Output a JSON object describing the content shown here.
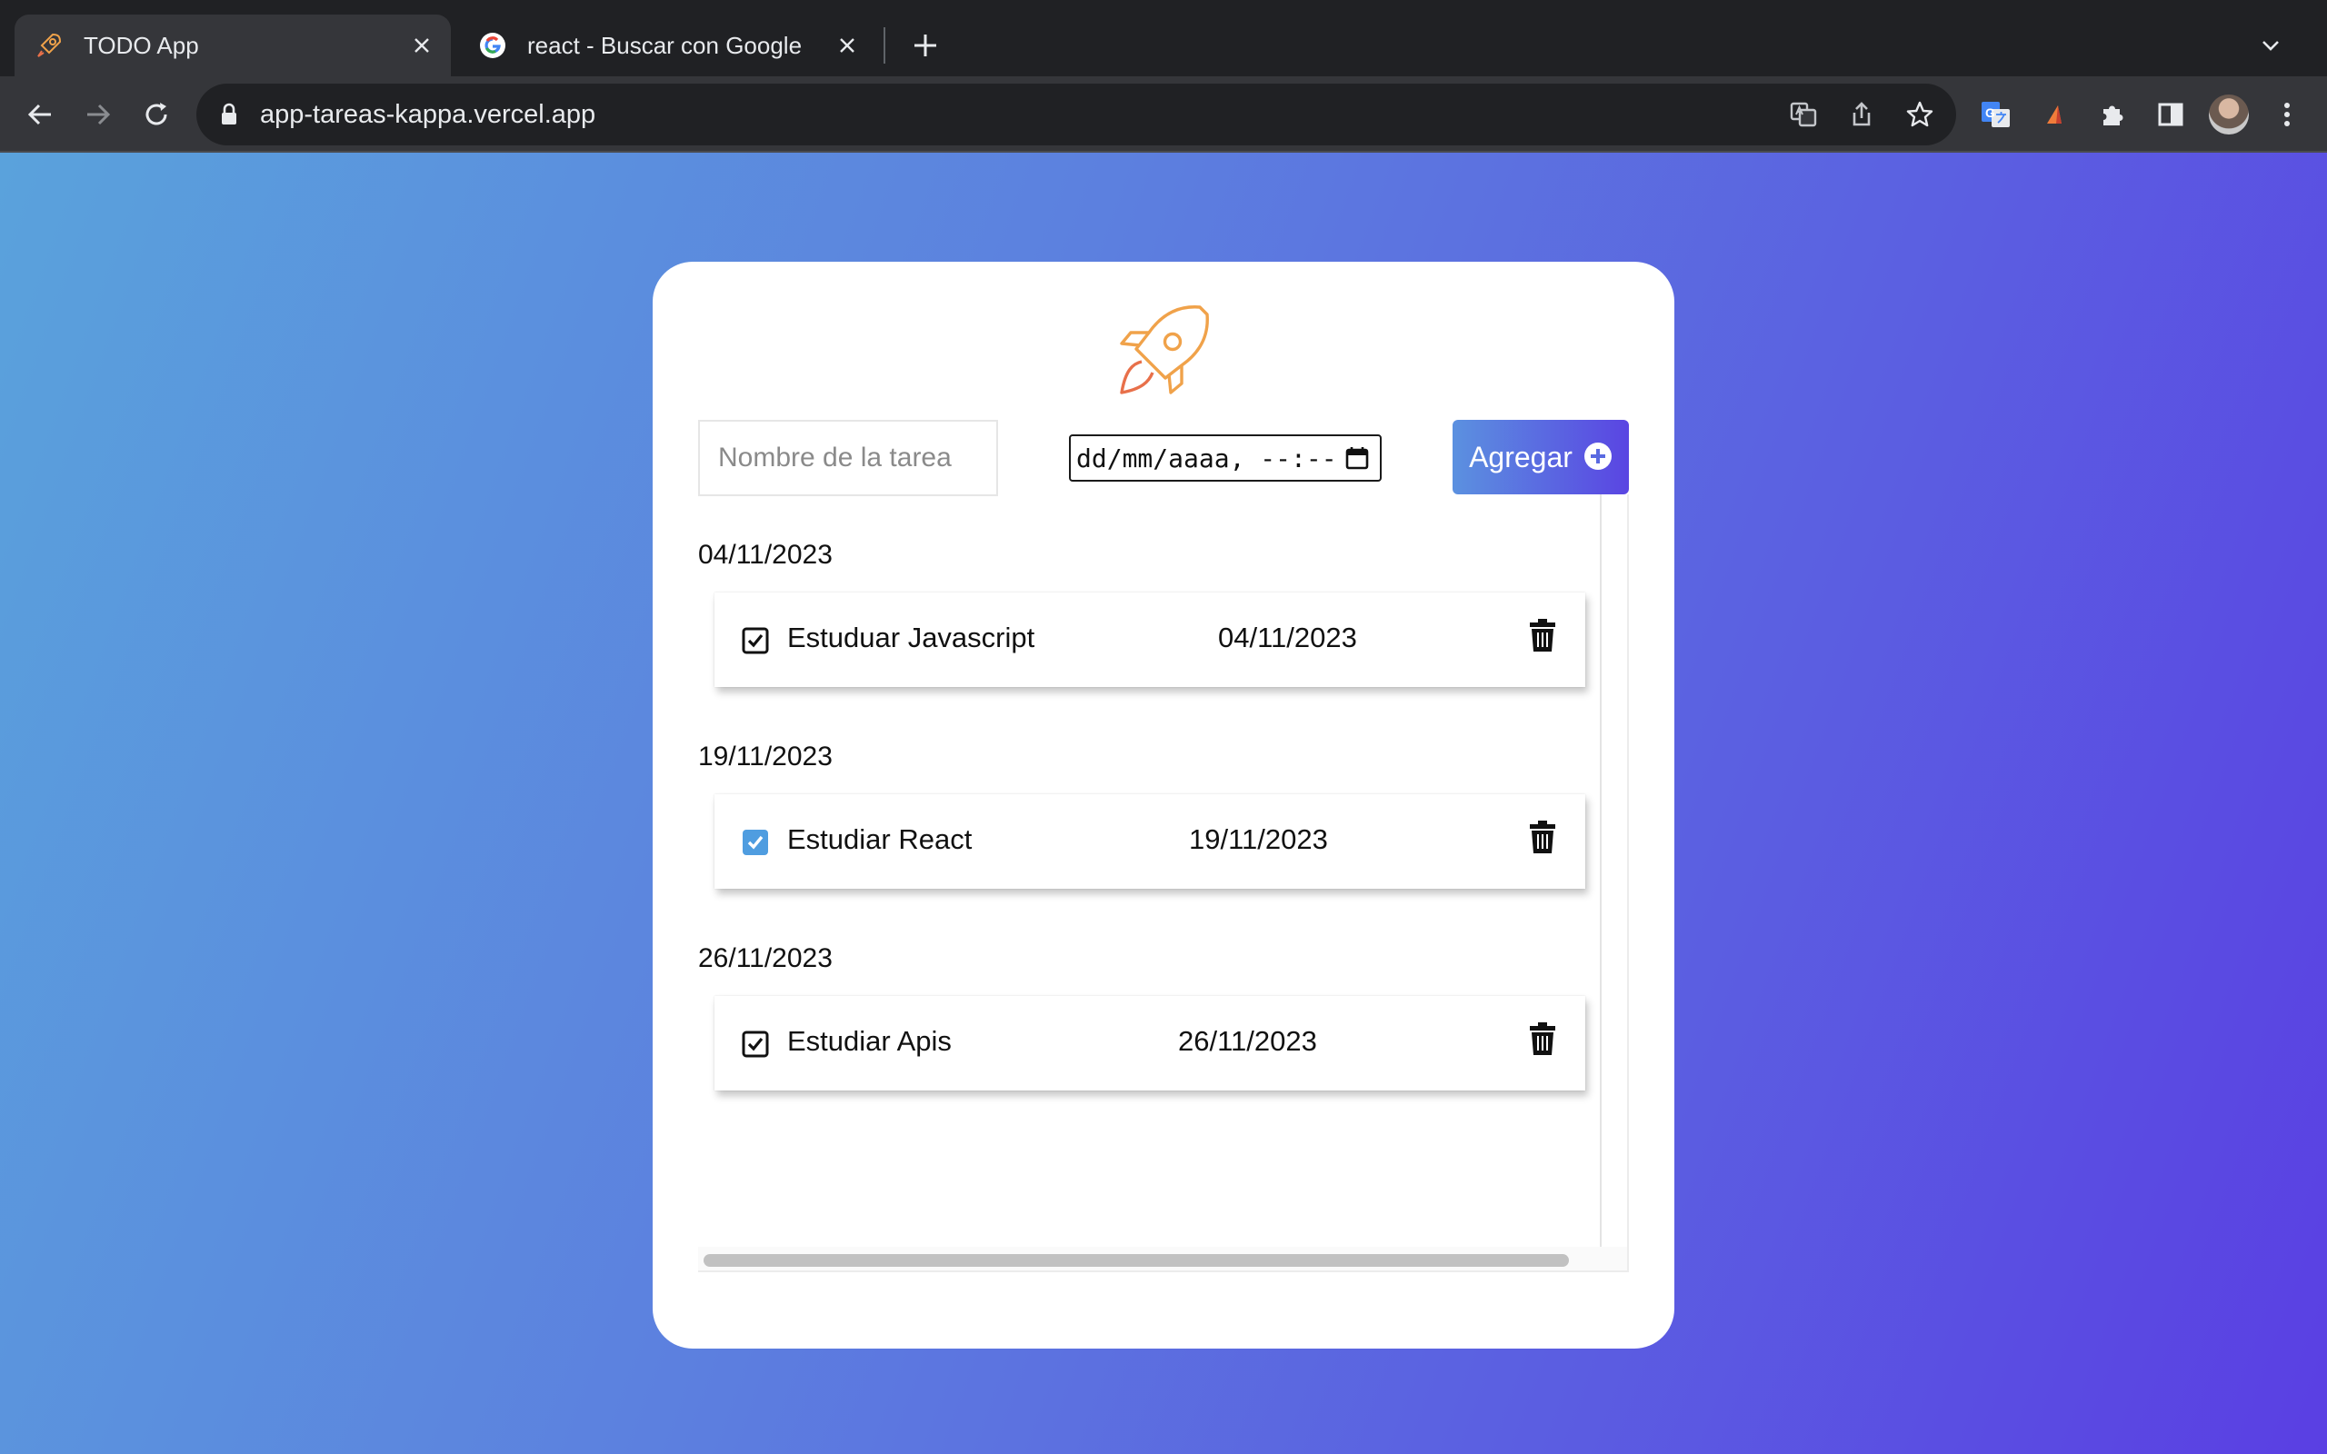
{
  "browser": {
    "tabs": [
      {
        "title": "TODO App",
        "active": true,
        "favicon": "rocket-icon"
      },
      {
        "title": "react - Buscar con Google",
        "active": false,
        "favicon": "google-icon"
      }
    ],
    "url": "app-tareas-kappa.vercel.app",
    "toolbar_icons": [
      "back-icon",
      "forward-icon",
      "reload-icon",
      "lock-icon",
      "translate-icon",
      "share-icon",
      "bookmark-star-icon",
      "google-translate-extension-icon",
      "extension-icon",
      "puzzle-icon",
      "side-panel-icon",
      "avatar",
      "kebab-menu-icon"
    ]
  },
  "app": {
    "task_input": {
      "placeholder": "Nombre de la tarea",
      "value": ""
    },
    "date_input": {
      "value": "dd/mm/aaaa, --:--"
    },
    "add_button": {
      "label": "Agregar"
    },
    "groups": [
      {
        "date": "04/11/2023",
        "tasks": [
          {
            "name": "Estuduar Javascript",
            "date": "04/11/2023",
            "checked": true,
            "check_style": "outline"
          }
        ]
      },
      {
        "date": "19/11/2023",
        "tasks": [
          {
            "name": "Estudiar React",
            "date": "19/11/2023",
            "checked": true,
            "check_style": "filled"
          }
        ]
      },
      {
        "date": "26/11/2023",
        "tasks": [
          {
            "name": "Estudiar Apis",
            "date": "26/11/2023",
            "checked": true,
            "check_style": "outline"
          }
        ]
      }
    ]
  },
  "colors": {
    "gradient_start": "#5aa2dc",
    "gradient_end": "#5a3fe3",
    "rocket": "#f0a24a",
    "checkbox_filled": "#4f9de0"
  }
}
